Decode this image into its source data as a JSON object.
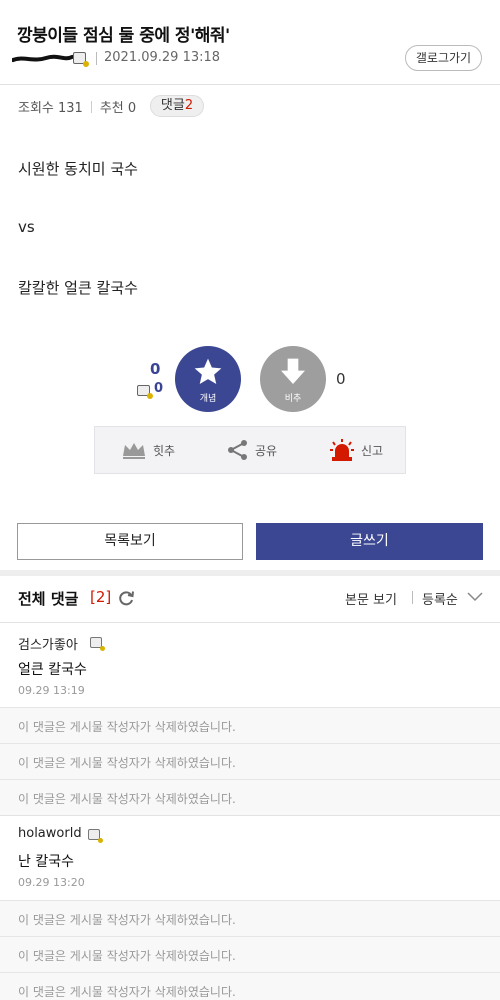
{
  "post": {
    "title": "깡붕이들 점심 둘 중에 정'해줘'",
    "date": "2021.09.29 13:18",
    "gallery_button": "갤로그가기",
    "views_label": "조회수 131",
    "recommend_label": "추천 0",
    "comments_label": "댓글",
    "comments_count": "2",
    "body": [
      "시원한 동치미 국수",
      "vs",
      "칼칼한 얼큰 칼국수"
    ]
  },
  "vote": {
    "up_count": "0",
    "fixed_count": "0",
    "up_label": "개념",
    "down_label": "비추",
    "down_count": "0"
  },
  "actions": {
    "hit": "힛추",
    "share": "공유",
    "report": "신고"
  },
  "buttons": {
    "list": "목록보기",
    "write": "글쓰기"
  },
  "comments_header": {
    "title": "전체 댓글",
    "count": "[2]",
    "view_body": "본문 보기",
    "sort": "등록순"
  },
  "comments": [
    {
      "nick": "검스가좋아",
      "text": "얼큰 칼국수",
      "time": "09.29 13:19"
    },
    {
      "nick": "holaworld",
      "text": "난 칼국수",
      "time": "09.29 13:20"
    }
  ],
  "deleted_text": "이 댓글은 게시물 작성자가 삭제하였습니다.",
  "colors": {
    "accent": "#3b4792",
    "red": "#d31900"
  }
}
